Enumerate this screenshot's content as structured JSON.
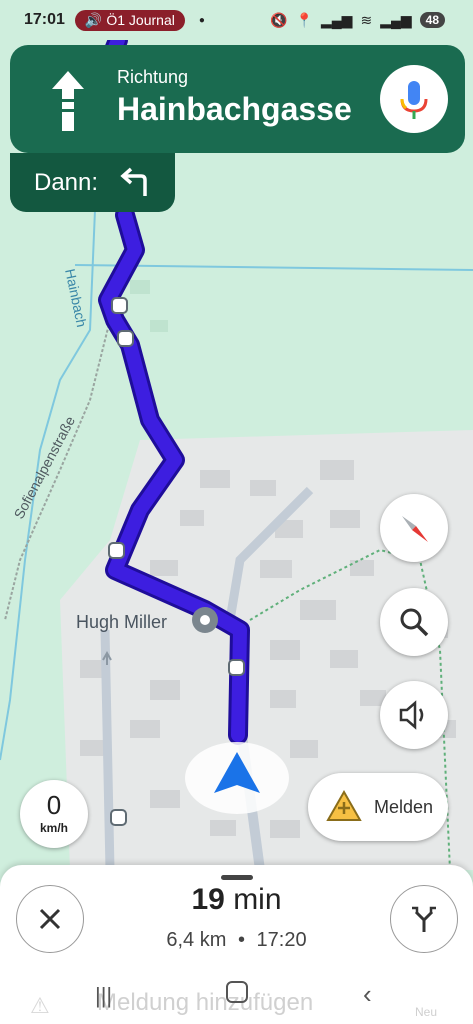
{
  "status": {
    "time": "17:01",
    "media_label": "Ö1 Journal",
    "battery": "48",
    "icons": [
      "mute-icon",
      "location-icon",
      "signal-icon",
      "wifi-icon",
      "signal-icon"
    ]
  },
  "banner": {
    "direction_label": "Richtung",
    "street": "Hainbachgasse",
    "maneuver_icon": "straight-arrow-icon",
    "then_label": "Dann:",
    "then_icon": "turn-left-icon"
  },
  "map": {
    "place_label": "Hugh Miller",
    "street_labels": [
      "Hainbach",
      "Sofienalpenstraße"
    ],
    "route_color": "#3d1ee0"
  },
  "speed": {
    "value": "0",
    "unit": "km/h"
  },
  "report": {
    "label": "Melden"
  },
  "trip": {
    "minutes": "19",
    "min_label": "min",
    "distance": "6,4 km",
    "arrival": "17:20",
    "separator": "•"
  },
  "footer": {
    "ghost_text": "Meldung hinzufügen",
    "ghost_badge": "Neu"
  }
}
